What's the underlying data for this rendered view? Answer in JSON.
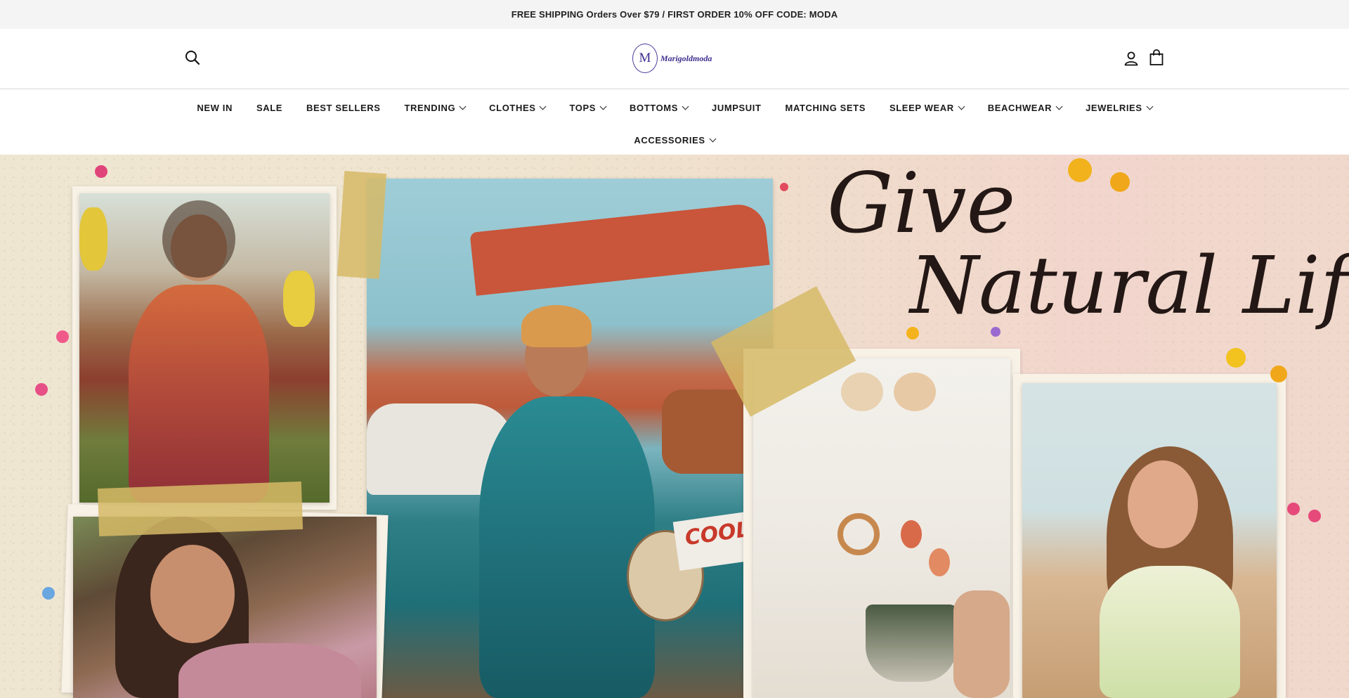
{
  "announcement": {
    "text": "FREE SHIPPING Orders Over $79  /  FIRST ORDER 10% OFF CODE: MODA"
  },
  "header": {
    "logo_mark": "M",
    "logo_text": "Marigoldmoda",
    "icons": [
      "search-icon",
      "account-icon",
      "cart-icon"
    ]
  },
  "nav": {
    "items": [
      {
        "label": "NEW IN",
        "dropdown": false
      },
      {
        "label": "SALE",
        "dropdown": false
      },
      {
        "label": "BEST SELLERS",
        "dropdown": false
      },
      {
        "label": "TRENDING",
        "dropdown": true
      },
      {
        "label": "CLOTHES",
        "dropdown": true
      },
      {
        "label": "TOPS",
        "dropdown": true
      },
      {
        "label": "BOTTOMS",
        "dropdown": true
      },
      {
        "label": "JUMPSUIT",
        "dropdown": false
      },
      {
        "label": "MATCHING SETS",
        "dropdown": false
      },
      {
        "label": "SLEEP WEAR",
        "dropdown": true
      },
      {
        "label": "BEACHWEAR",
        "dropdown": true
      },
      {
        "label": "JEWELRIES",
        "dropdown": true
      },
      {
        "label": "ACCESSORIES",
        "dropdown": true
      }
    ]
  },
  "hero": {
    "headline_line1": "Give",
    "headline_line2": "Natural Life",
    "photo_text": "COOL"
  },
  "colors": {
    "announcement_bg": "#f4f4f4",
    "brand": "#3e2f8f",
    "hero_bg": "#efe6d2",
    "tape": "#d6ba66"
  }
}
